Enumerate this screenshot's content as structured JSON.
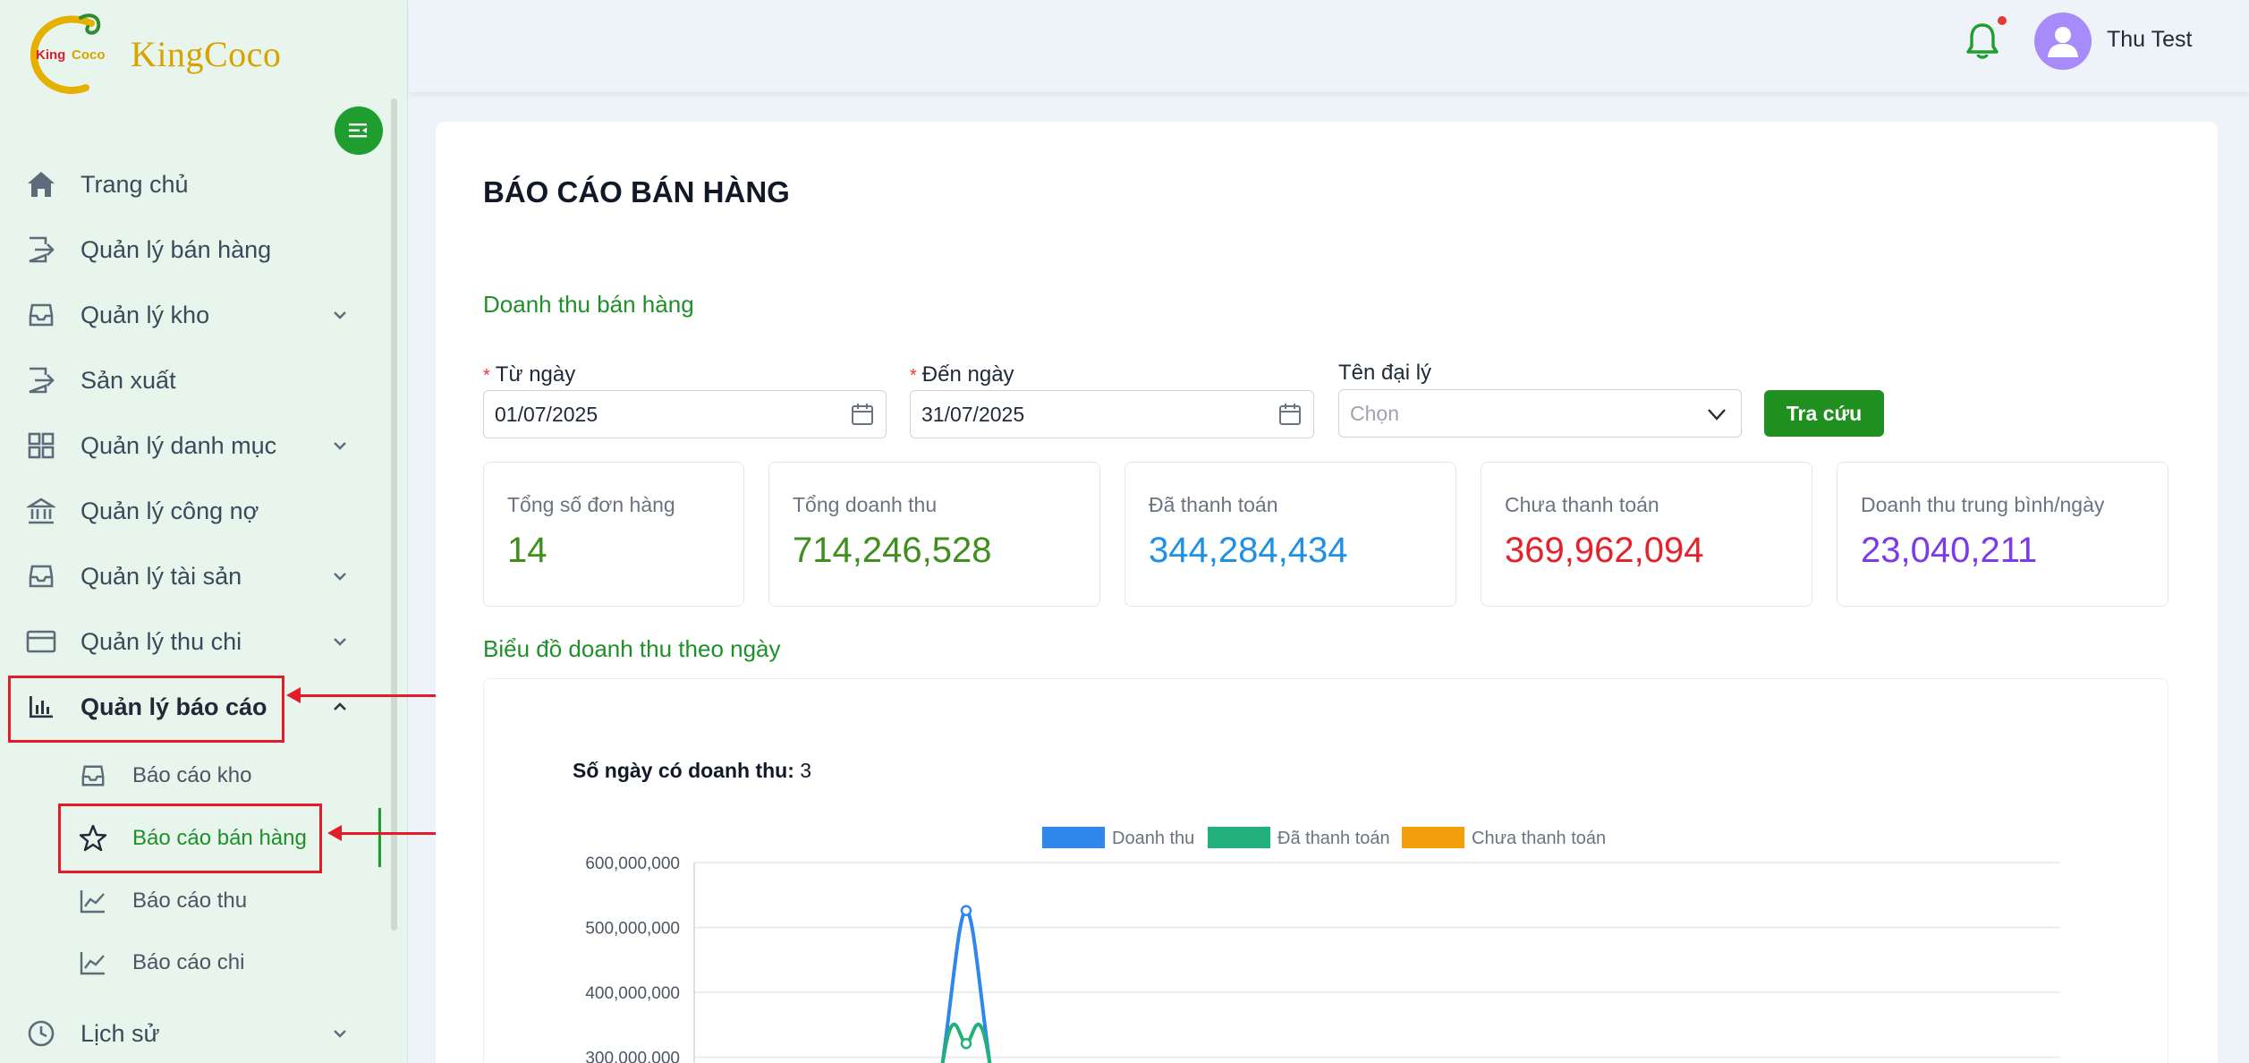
{
  "brand": {
    "name": "KingCoco",
    "logo_text": "KingCoco"
  },
  "sidebar": {
    "items": [
      {
        "label": "Trang chủ",
        "icon": "home-icon"
      },
      {
        "label": "Quản lý bán hàng",
        "icon": "export-icon"
      },
      {
        "label": "Quản lý kho",
        "icon": "inbox-icon",
        "expandable": true
      },
      {
        "label": "Sản xuất",
        "icon": "export-icon"
      },
      {
        "label": "Quản lý danh mục",
        "icon": "grid-icon",
        "expandable": true
      },
      {
        "label": "Quản lý công nợ",
        "icon": "bank-icon"
      },
      {
        "label": "Quản lý tài sản",
        "icon": "inbox-icon",
        "expandable": true
      },
      {
        "label": "Quản lý thu chi",
        "icon": "wallet-icon",
        "expandable": true
      },
      {
        "label": "Quản lý báo cáo",
        "icon": "bar-chart-icon",
        "expandable": true,
        "expanded": true
      },
      {
        "label": "Lịch sử",
        "icon": "clock-icon",
        "expandable": true
      }
    ],
    "sub_items": [
      {
        "label": "Báo cáo kho",
        "icon": "inbox-icon"
      },
      {
        "label": "Báo cáo bán hàng",
        "icon": "star-icon",
        "active": true
      },
      {
        "label": "Báo cáo thu",
        "icon": "line-chart-icon"
      },
      {
        "label": "Báo cáo chi",
        "icon": "line-chart-icon"
      }
    ]
  },
  "header": {
    "user_name": "Thu Test",
    "has_notification": true
  },
  "page": {
    "title": "BÁO CÁO BÁN HÀNG",
    "section_revenue": "Doanh thu bán hàng",
    "section_chart": "Biểu đồ doanh thu theo ngày"
  },
  "filters": {
    "from_label": "Từ ngày",
    "from_value": "01/07/2025",
    "to_label": "Đến ngày",
    "to_value": "31/07/2025",
    "agent_label": "Tên đại lý",
    "agent_placeholder": "Chọn",
    "required_mark": "*",
    "search_label": "Tra cứu"
  },
  "stats": [
    {
      "label": "Tổng số đơn hàng",
      "value": "14",
      "color": "#3f8f1f"
    },
    {
      "label": "Tổng doanh thu",
      "value": "714,246,528",
      "color": "#3f8f1f"
    },
    {
      "label": "Đã thanh toán",
      "value": "344,284,434",
      "color": "#1e90e6"
    },
    {
      "label": "Chưa thanh toán",
      "value": "369,962,094",
      "color": "#e5222c"
    },
    {
      "label": "Doanh thu trung bình/ngày",
      "value": "23,040,211",
      "color": "#7c3aed"
    }
  ],
  "days_with_revenue": {
    "label": "Số ngày có doanh thu:",
    "value": "3"
  },
  "colors": {
    "accent": "#1f8f1f",
    "highlight": "#e11d2a"
  },
  "chart_data": {
    "type": "line",
    "legend": [
      "Doanh thu",
      "Đã thanh toán",
      "Chưa thanh toán"
    ],
    "legend_colors": [
      "#2f86eb",
      "#22b07d",
      "#f59e0b"
    ],
    "yticks": [
      "600,000,000",
      "500,000,000",
      "400,000,000",
      "300,000,000"
    ],
    "ylim": [
      0,
      600000000
    ],
    "visible_ylim": [
      300000000,
      600000000
    ],
    "series": [
      {
        "name": "Doanh thu",
        "peak": 526000000,
        "color": "#2f86eb"
      },
      {
        "name": "Đã thanh toán",
        "peak": 321000000,
        "color": "#22b07d"
      }
    ],
    "grid": true,
    "legend_position": "top-center"
  }
}
